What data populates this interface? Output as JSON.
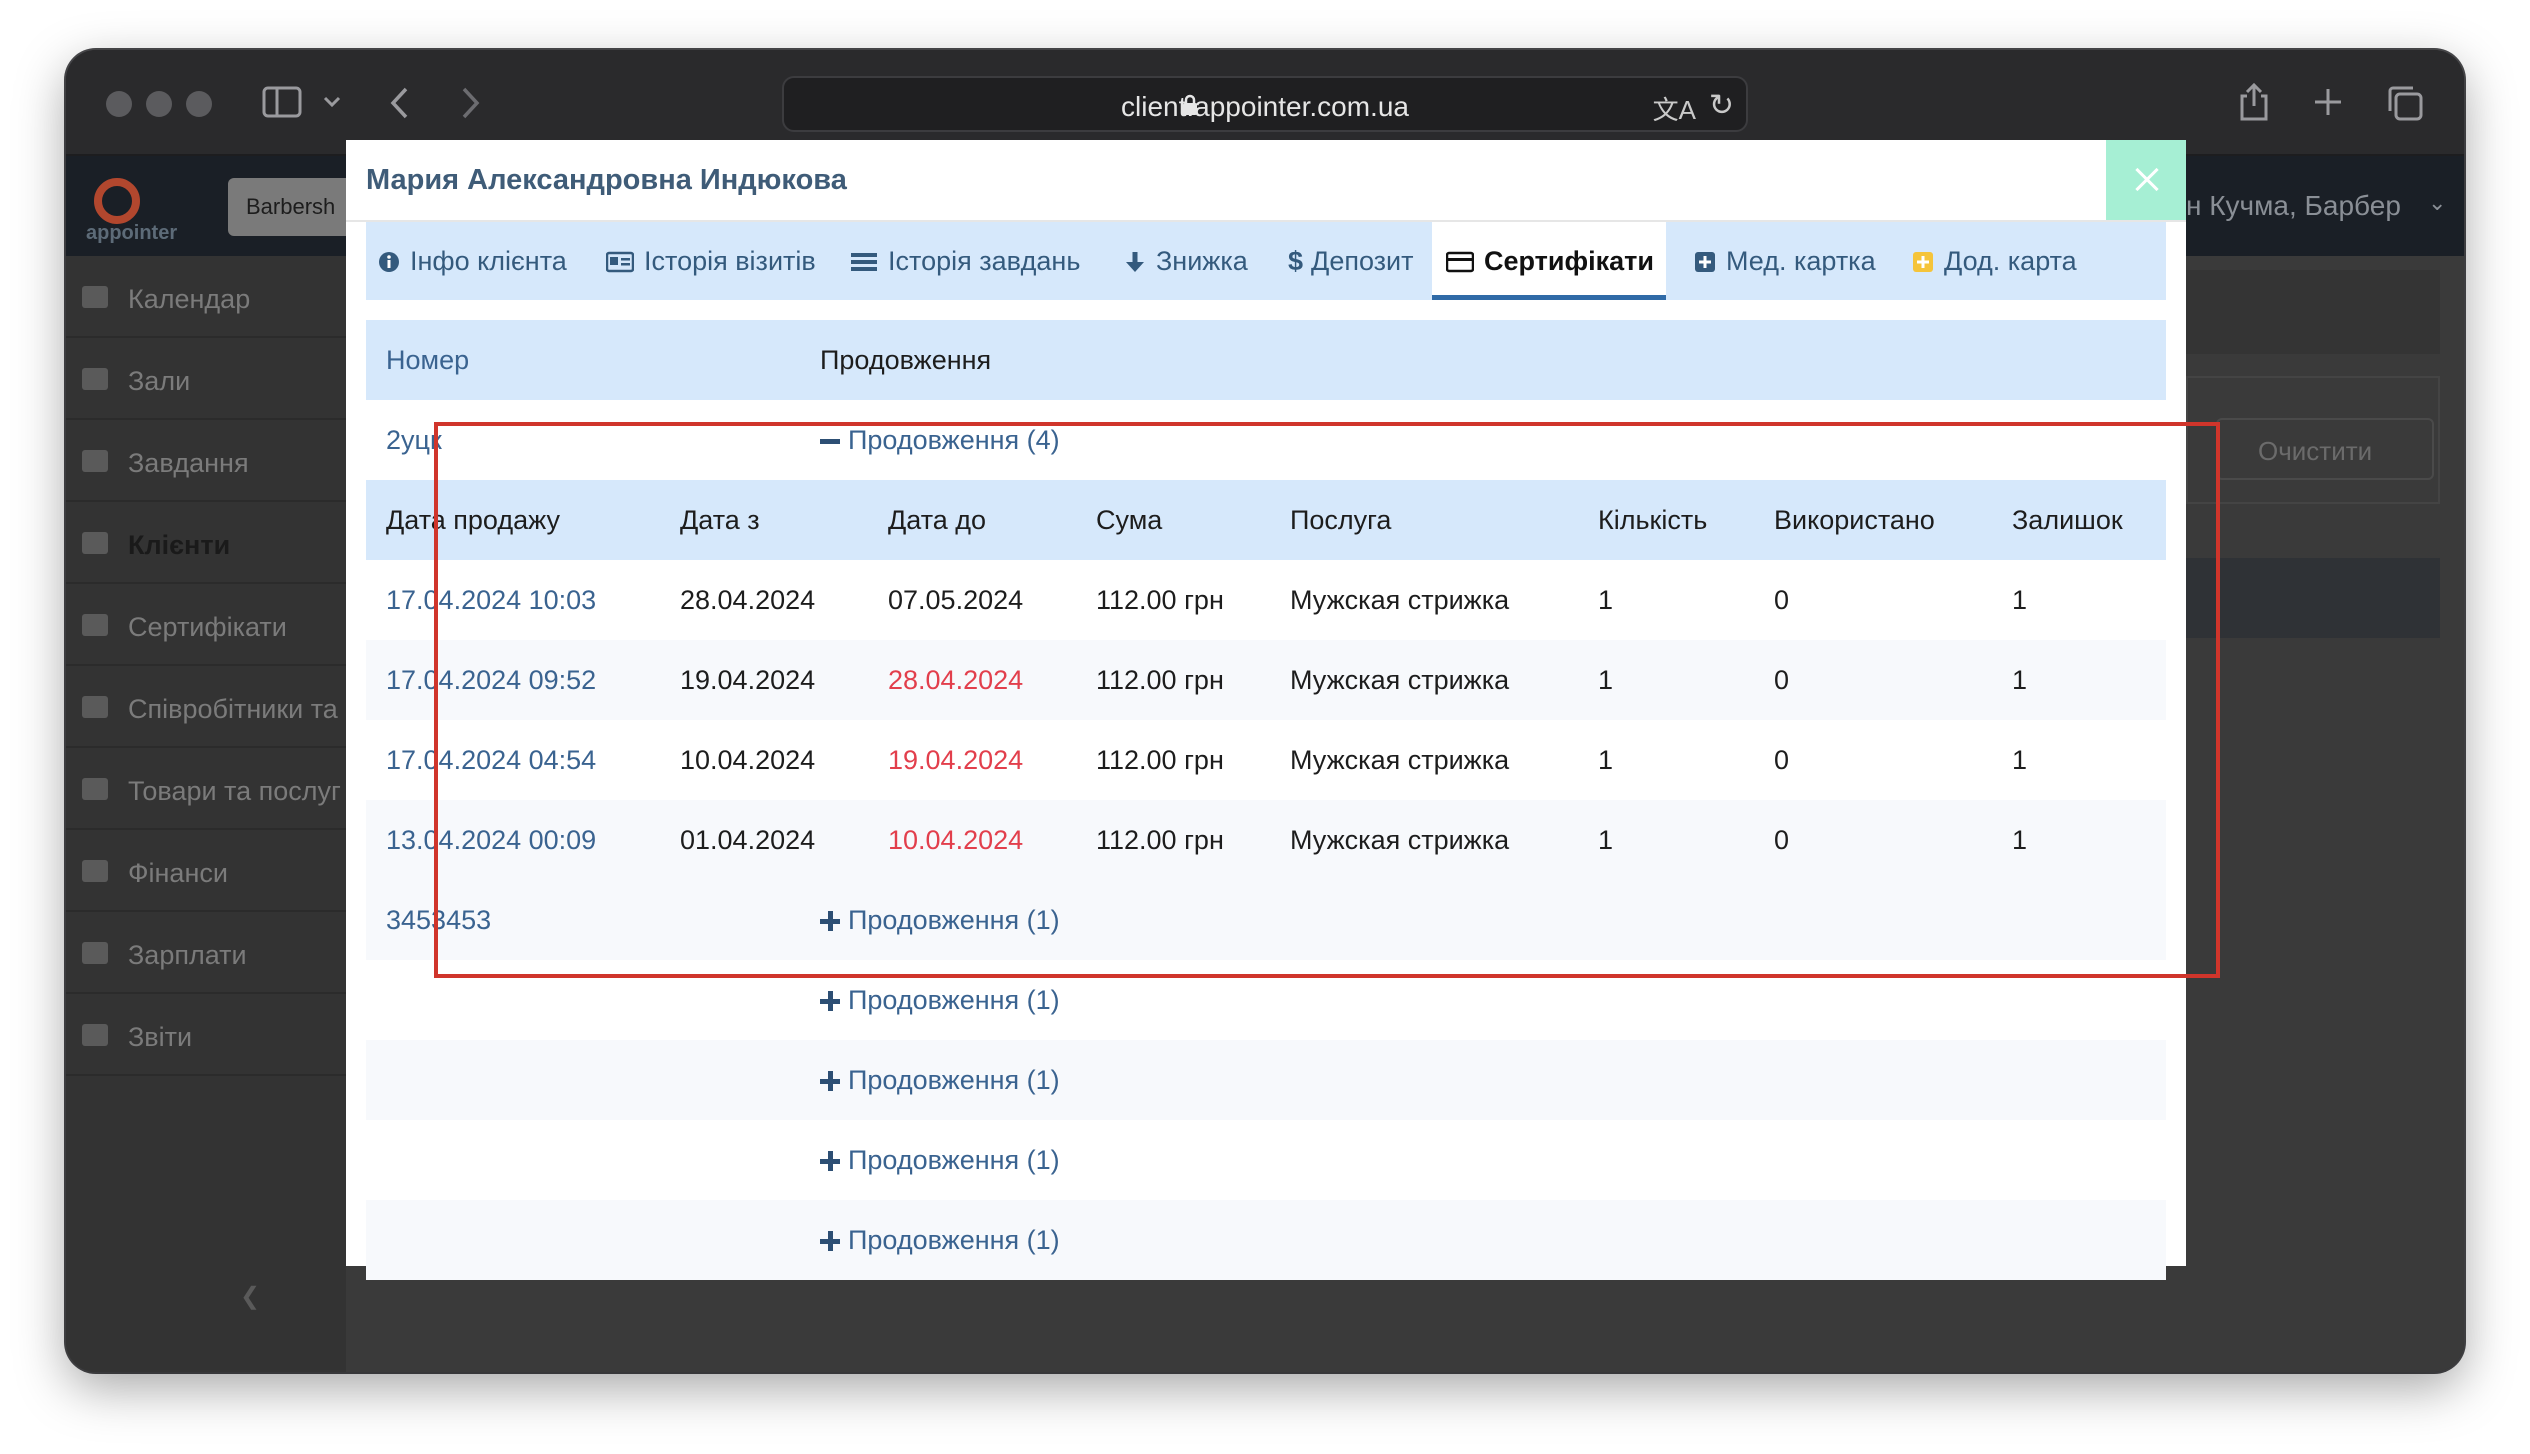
{
  "browser": {
    "url": "client.appointer.com.ua"
  },
  "app": {
    "logo_text": "appointer",
    "top_search_value": "Barbersh",
    "user_label": "н Кучма, Барбер",
    "clear_button": "Очистити",
    "sidebar": [
      {
        "label": "Календар",
        "active": false
      },
      {
        "label": "Зали",
        "active": false
      },
      {
        "label": "Завдання",
        "active": false
      },
      {
        "label": "Клієнти",
        "active": true
      },
      {
        "label": "Сертифікати",
        "active": false
      },
      {
        "label": "Співробітники та",
        "active": false
      },
      {
        "label": "Товари та послуг",
        "active": false
      },
      {
        "label": "Фінанси",
        "active": false
      },
      {
        "label": "Зарплати",
        "active": false
      },
      {
        "label": "Звіти",
        "active": false
      }
    ]
  },
  "modal": {
    "title": "Мария Александровна Индюкова",
    "tabs": [
      {
        "label": "Інфо клієнта",
        "icon": "info-icon",
        "active": false
      },
      {
        "label": "Історія візитів",
        "icon": "id-card-icon",
        "active": false
      },
      {
        "label": "Історія завдань",
        "icon": "list-icon",
        "active": false
      },
      {
        "label": "Знижка",
        "icon": "arrow-down-icon",
        "active": false
      },
      {
        "label": "Депозит",
        "icon": "dollar-icon",
        "active": false
      },
      {
        "label": "Сертифікати",
        "icon": "credit-card-icon",
        "active": true
      },
      {
        "label": "Мед. картка",
        "icon": "plus-square-icon",
        "active": false
      },
      {
        "label": "Дод. карта",
        "icon": "plus-square-yellow-icon",
        "active": false
      }
    ],
    "table": {
      "headers": {
        "number": "Номер",
        "extension": "Продовження"
      },
      "certificates": [
        {
          "number": "2уцк",
          "extension_label": "Продовження (4)",
          "expanded": true
        },
        {
          "number": "3453453",
          "extension_label": "Продовження (1)",
          "expanded": false
        },
        {
          "number": "",
          "extension_label": "Продовження (1)",
          "expanded": false
        },
        {
          "number": "",
          "extension_label": "Продовження (1)",
          "expanded": false
        },
        {
          "number": "",
          "extension_label": "Продовження (1)",
          "expanded": false
        },
        {
          "number": "",
          "extension_label": "Продовження (1)",
          "expanded": false
        }
      ],
      "sub_headers": [
        "Дата продажу",
        "Дата з",
        "Дата до",
        "Сума",
        "Послуга",
        "Кількість",
        "Використано",
        "Залишок"
      ],
      "sub_rows": [
        {
          "sale_date": "17.04.2024 10:03",
          "date_from": "28.04.2024",
          "date_to": "07.05.2024",
          "date_to_expired": false,
          "amount": "112.00 грн",
          "service": "Мужская стрижка",
          "qty": "1",
          "used": "0",
          "remaining": "1"
        },
        {
          "sale_date": "17.04.2024 09:52",
          "date_from": "19.04.2024",
          "date_to": "28.04.2024",
          "date_to_expired": true,
          "amount": "112.00 грн",
          "service": "Мужская стрижка",
          "qty": "1",
          "used": "0",
          "remaining": "1"
        },
        {
          "sale_date": "17.04.2024 04:54",
          "date_from": "10.04.2024",
          "date_to": "19.04.2024",
          "date_to_expired": true,
          "amount": "112.00 грн",
          "service": "Мужская стрижка",
          "qty": "1",
          "used": "0",
          "remaining": "1"
        },
        {
          "sale_date": "13.04.2024 00:09",
          "date_from": "01.04.2024",
          "date_to": "10.04.2024",
          "date_to_expired": true,
          "amount": "112.00 грн",
          "service": "Мужская стрижка",
          "qty": "1",
          "used": "0",
          "remaining": "1"
        }
      ]
    }
  },
  "colors": {
    "tab_bar_bg": "#d6e8fb",
    "link_blue": "#3a6390",
    "expired_red": "#e23f4c",
    "highlight_red": "#d0352b",
    "close_button_bg": "#a6efd4"
  }
}
